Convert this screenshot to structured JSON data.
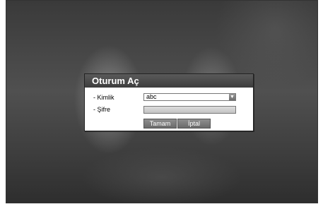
{
  "dialog": {
    "title": "Oturum Aç",
    "fields": {
      "id_label": "- Kimlik",
      "id_value": "abc",
      "password_label": "- Şifre",
      "password_value": ""
    },
    "buttons": {
      "ok_label": "Tamam",
      "cancel_label": "İptal"
    },
    "icons": {
      "dropdown": "chevron-down-icon"
    }
  }
}
